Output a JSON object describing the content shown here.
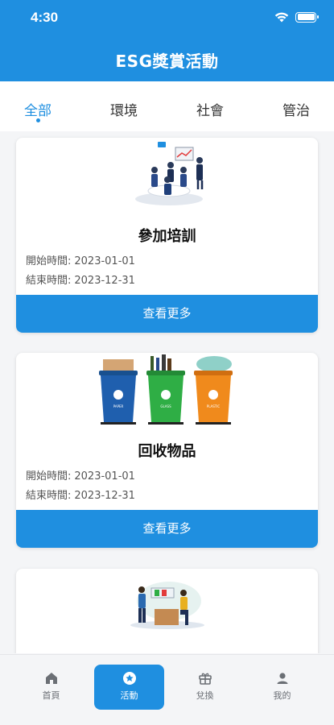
{
  "status_bar": {
    "time": "4:30"
  },
  "header": {
    "title": "ESG獎賞活動"
  },
  "tabs": [
    {
      "label": "全部",
      "active": true
    },
    {
      "label": "環境",
      "active": false
    },
    {
      "label": "社會",
      "active": false
    },
    {
      "label": "管治",
      "active": false
    }
  ],
  "activities": [
    {
      "title": "參加培訓",
      "start_label": "開始時間:",
      "start_date": "2023-01-01",
      "end_label": "結束時間:",
      "end_date": "2023-12-31",
      "button_label": "查看更多",
      "image_icon": "training-meeting-illustration"
    },
    {
      "title": "回收物品",
      "start_label": "開始時間:",
      "start_date": "2023-01-01",
      "end_label": "結束時間:",
      "end_date": "2023-12-31",
      "button_label": "查看更多",
      "image_icon": "recycling-bins-illustration",
      "bin_labels": [
        "PAPER",
        "GLASS",
        "PLASTIC"
      ]
    },
    {
      "image_icon": "donation-volunteers-illustration"
    }
  ],
  "bottom_nav": [
    {
      "label": "首頁",
      "icon": "home-icon",
      "active": false
    },
    {
      "label": "活動",
      "icon": "star-badge-icon",
      "active": true
    },
    {
      "label": "兌換",
      "icon": "gift-icon",
      "active": false
    },
    {
      "label": "我的",
      "icon": "person-icon",
      "active": false
    }
  ],
  "colors": {
    "primary": "#1f8fe0",
    "paper_bin": "#1f5fae",
    "glass_bin": "#2fae45",
    "plastic_bin": "#f08a1c"
  }
}
